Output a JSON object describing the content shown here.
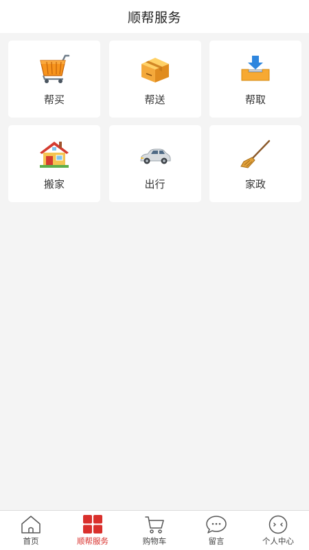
{
  "header": {
    "title": "顺帮服务"
  },
  "services": [
    {
      "label": "帮买",
      "icon": "shopping-cart-icon"
    },
    {
      "label": "帮送",
      "icon": "package-box-icon"
    },
    {
      "label": "帮取",
      "icon": "inbox-download-icon"
    },
    {
      "label": "搬家",
      "icon": "house-icon"
    },
    {
      "label": "出行",
      "icon": "car-icon"
    },
    {
      "label": "家政",
      "icon": "broom-icon"
    }
  ],
  "tabbar": {
    "active_index": 1,
    "active_color": "#d9302c",
    "items": [
      {
        "label": "首页",
        "icon": "home-icon"
      },
      {
        "label": "顺帮服务",
        "icon": "grid-icon"
      },
      {
        "label": "购物车",
        "icon": "cart-icon"
      },
      {
        "label": "留言",
        "icon": "chat-bubble-icon"
      },
      {
        "label": "个人中心",
        "icon": "profile-face-icon"
      }
    ]
  }
}
